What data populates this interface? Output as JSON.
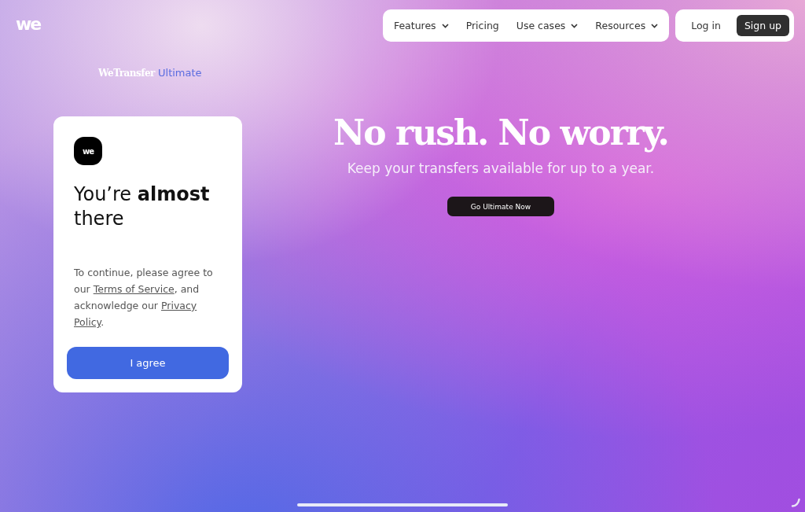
{
  "logo": "we",
  "nav": {
    "items": [
      {
        "label": "Features",
        "dropdown": true
      },
      {
        "label": "Pricing",
        "dropdown": false
      },
      {
        "label": "Use cases",
        "dropdown": true
      },
      {
        "label": "Resources",
        "dropdown": true
      }
    ],
    "login": "Log in",
    "signup": "Sign up"
  },
  "brand": {
    "name": "WeTransfer",
    "product": "Ultimate"
  },
  "card": {
    "badge": "we",
    "heading": "You’re **almost** there",
    "body": [
      {
        "kind": "text",
        "text": "To continue, please agree to our "
      },
      {
        "kind": "link",
        "text": "Terms of Service"
      },
      {
        "kind": "text",
        "text": ", and acknowledge our "
      },
      {
        "kind": "link",
        "text": "Privacy"
      },
      {
        "kind": "link",
        "text": "Policy"
      },
      {
        "kind": "text",
        "text": "."
      }
    ],
    "button": "I agree"
  },
  "hero": {
    "title": "No rush. No worry.",
    "subtitle": "Keep your transfers available for up to a year.",
    "button": "Go Ultimate Now"
  }
}
